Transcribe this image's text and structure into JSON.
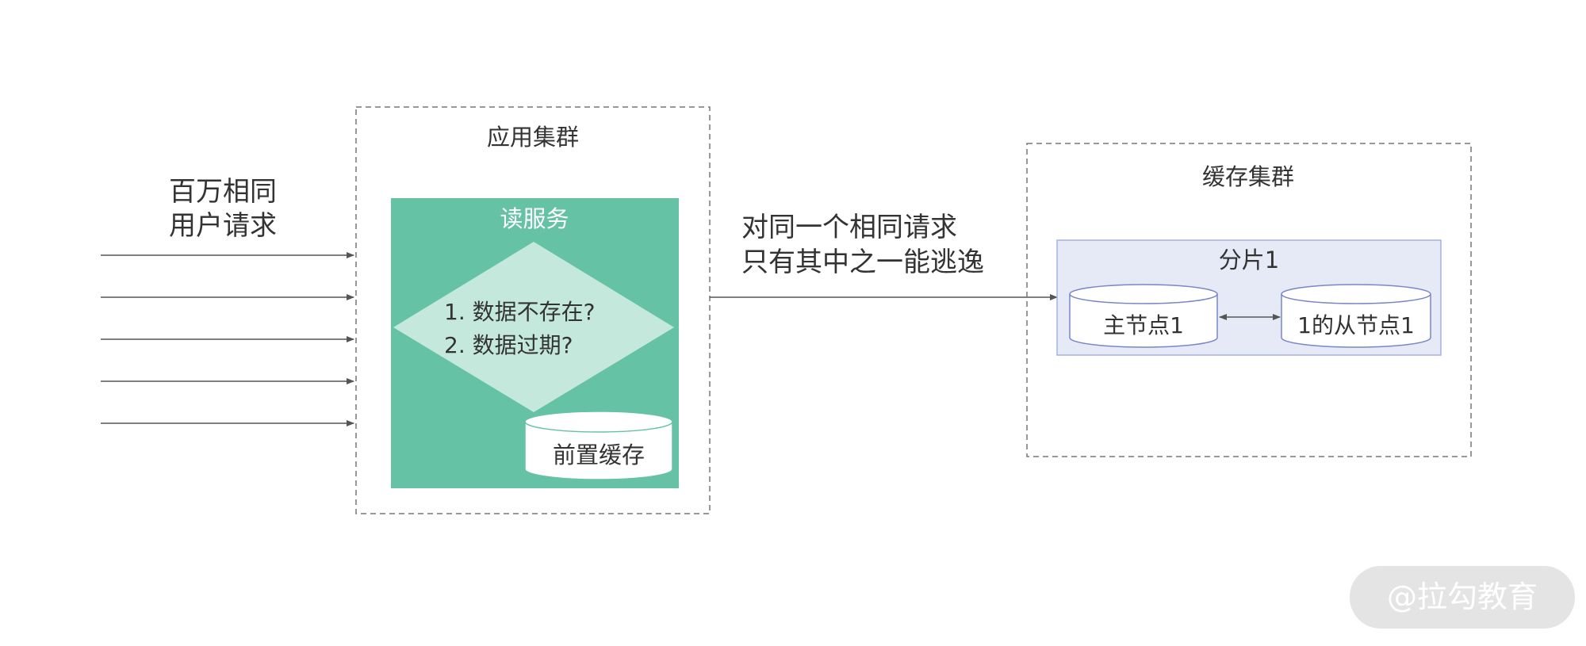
{
  "left_text": {
    "line1": "百万相同",
    "line2": "用户请求"
  },
  "app_cluster": {
    "title": "应用集群",
    "read_service": {
      "title": "读服务",
      "decision_line1": "1. 数据不存在?",
      "decision_line2": "2. 数据过期?",
      "cache_label": "前置缓存"
    }
  },
  "middle_text": {
    "line1": "对同一个相同请求",
    "line2": "只有其中之一能逃逸"
  },
  "cache_cluster": {
    "title": "缓存集群",
    "shard": {
      "title": "分片1",
      "primary_label": "主节点1",
      "replica_label": "1的从节点1"
    }
  },
  "watermark": "@拉勾教育",
  "colors": {
    "read_service_fill": "#66c2a5",
    "decision_fill": "#c4e8db",
    "shard_fill": "#e6e9f6",
    "shard_border": "#a5b1df",
    "node_stroke": "#7a86c8",
    "arrow": "#555555",
    "dashed_border": "#777777",
    "watermark_bg": "#e4e4e4",
    "watermark_text": "#ffffff"
  }
}
